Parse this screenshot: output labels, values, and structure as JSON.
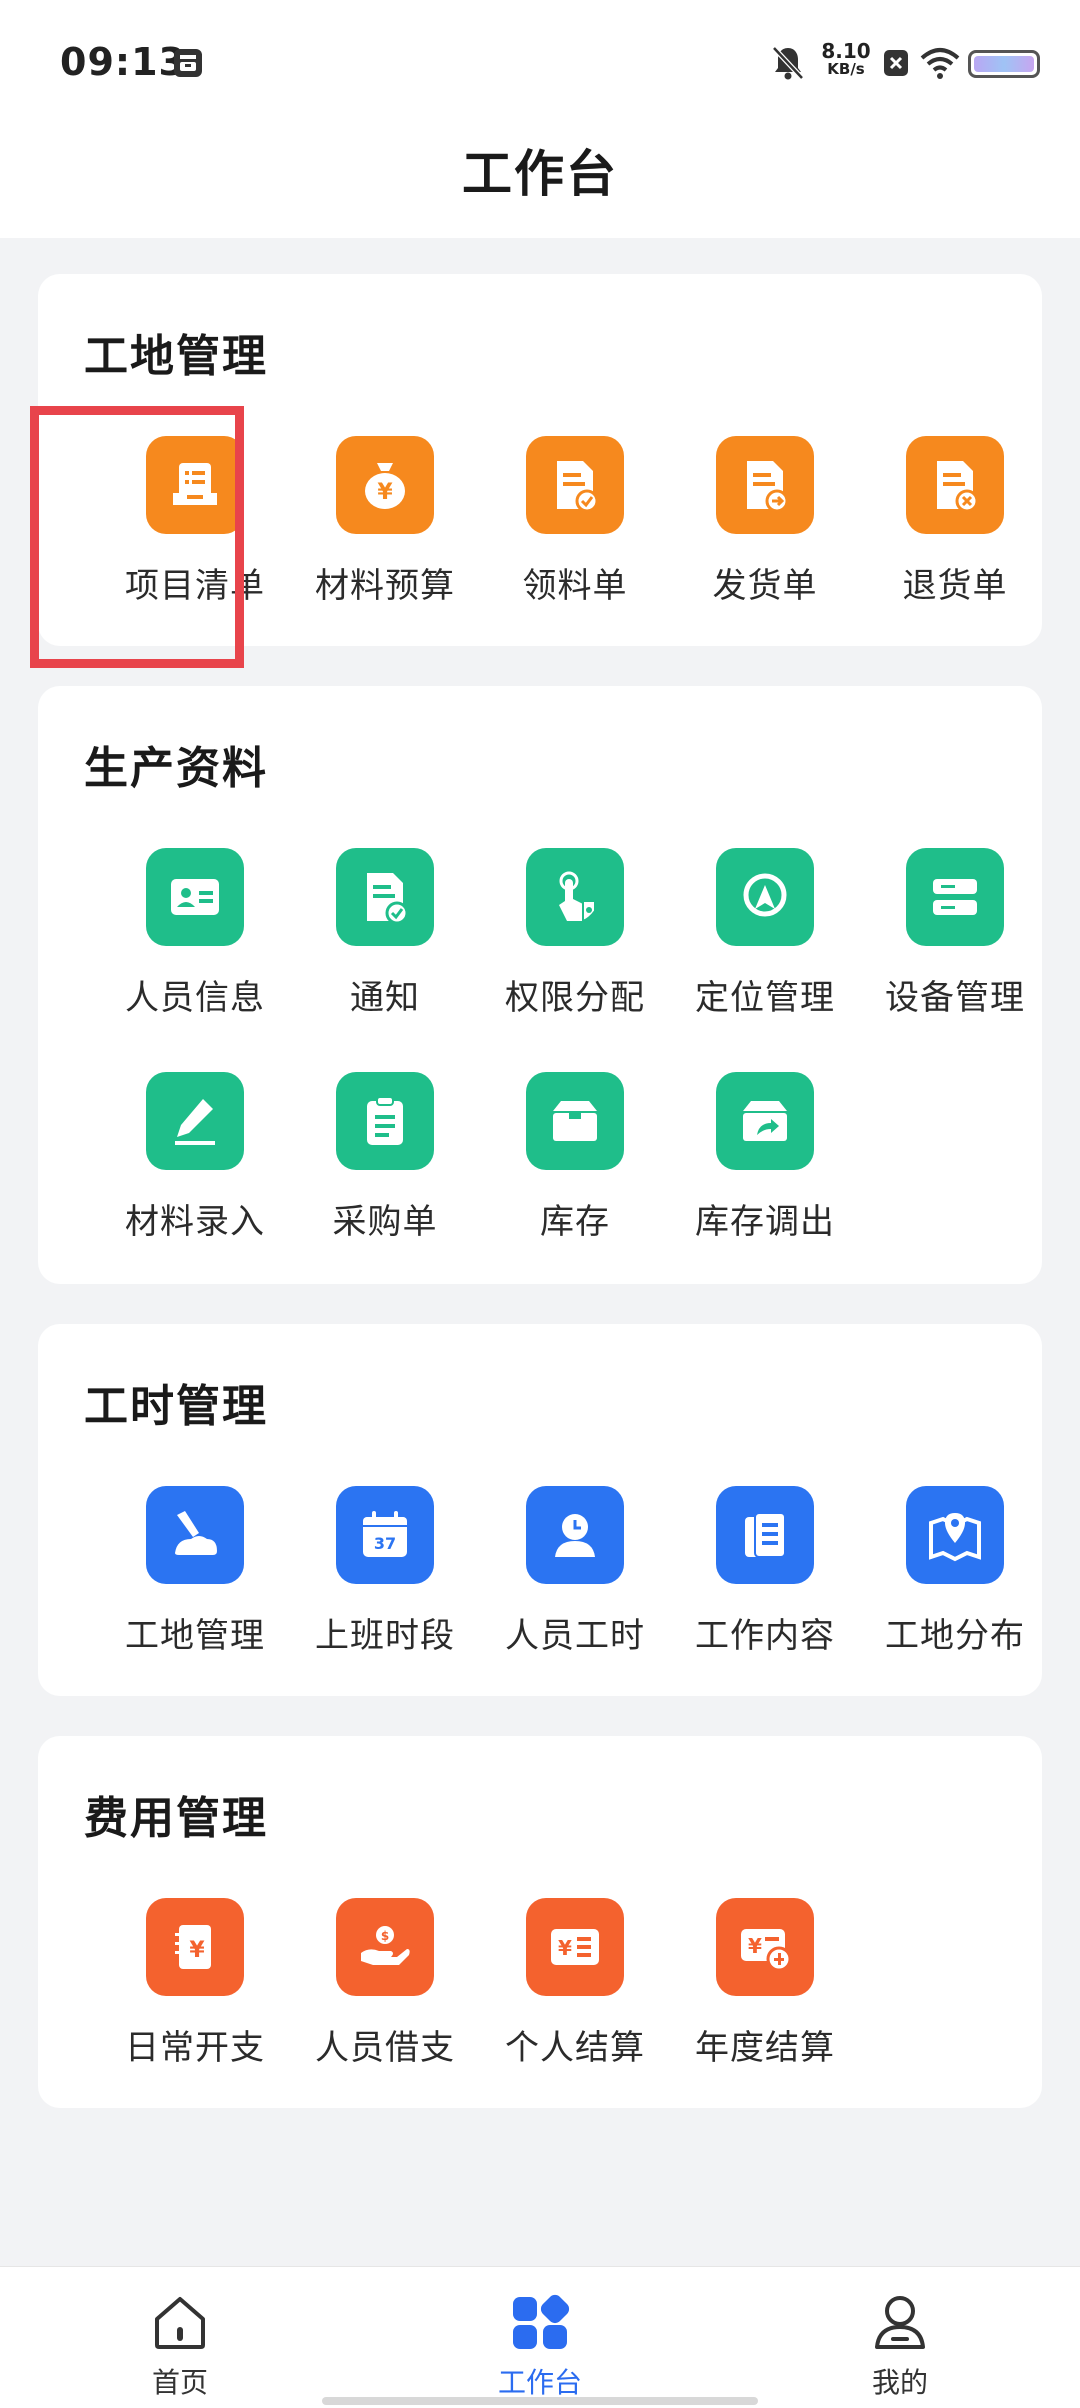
{
  "status_bar": {
    "time": "09:13",
    "net_speed": "8.10",
    "net_unit": "KB/s"
  },
  "header": {
    "title": "工作台"
  },
  "sections": [
    {
      "title": "工地管理",
      "items": [
        {
          "label": "项目清单",
          "icon": "document-list-icon"
        },
        {
          "label": "材料预算",
          "icon": "money-bag-icon"
        },
        {
          "label": "领料单",
          "icon": "receipt-check-icon"
        },
        {
          "label": "发货单",
          "icon": "receipt-send-icon"
        },
        {
          "label": "退货单",
          "icon": "receipt-return-icon"
        }
      ]
    },
    {
      "title": "生产资料",
      "items": [
        {
          "label": "人员信息",
          "icon": "id-card-icon"
        },
        {
          "label": "通知",
          "icon": "notice-icon"
        },
        {
          "label": "权限分配",
          "icon": "permission-icon"
        },
        {
          "label": "定位管理",
          "icon": "location-icon"
        },
        {
          "label": "设备管理",
          "icon": "device-icon"
        },
        {
          "label": "材料录入",
          "icon": "edit-icon"
        },
        {
          "label": "采购单",
          "icon": "clipboard-icon"
        },
        {
          "label": "库存",
          "icon": "box-icon"
        },
        {
          "label": "库存调出",
          "icon": "box-export-icon"
        }
      ]
    },
    {
      "title": "工时管理",
      "items": [
        {
          "label": "工地管理",
          "icon": "construction-icon"
        },
        {
          "label": "上班时段",
          "icon": "calendar-icon"
        },
        {
          "label": "人员工时",
          "icon": "person-clock-icon"
        },
        {
          "label": "工作内容",
          "icon": "notes-icon"
        },
        {
          "label": "工地分布",
          "icon": "map-pin-icon"
        }
      ]
    },
    {
      "title": "费用管理",
      "items": [
        {
          "label": "日常开支",
          "icon": "expense-icon"
        },
        {
          "label": "人员借支",
          "icon": "loan-hand-icon"
        },
        {
          "label": "个人结算",
          "icon": "personal-settle-icon"
        },
        {
          "label": "年度结算",
          "icon": "annual-settle-icon"
        }
      ]
    }
  ],
  "tab_bar": {
    "items": [
      {
        "label": "首页",
        "icon": "home-icon"
      },
      {
        "label": "工作台",
        "icon": "workbench-icon",
        "active": true
      },
      {
        "label": "我的",
        "icon": "profile-icon"
      }
    ]
  },
  "colors": {
    "orange": "#f6891e",
    "green": "#1fbe8a",
    "blue": "#2b74f2",
    "red": "#f4622e",
    "tab_active": "#2b6cf0",
    "highlight": "#e8444b"
  }
}
